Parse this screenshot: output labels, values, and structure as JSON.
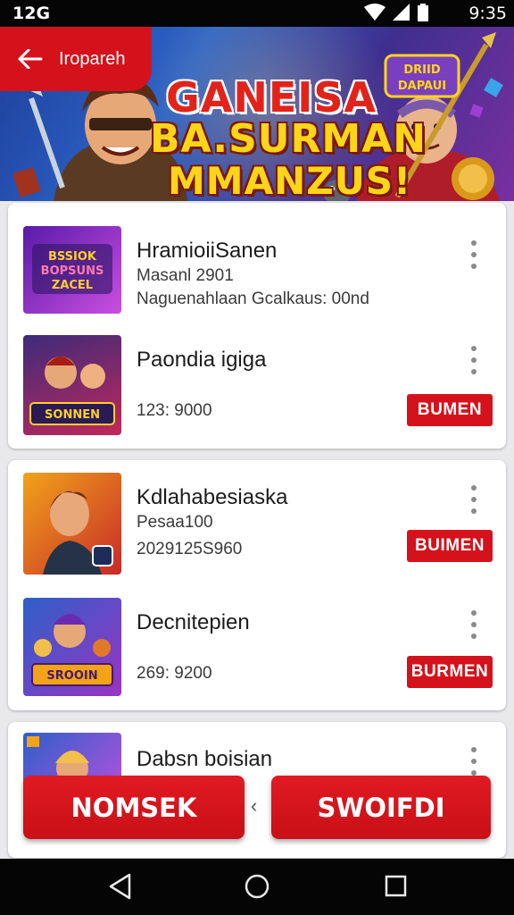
{
  "status_bar": {
    "time_left": "12G",
    "time_right": "9:35"
  },
  "header": {
    "back_label": "Iropareh"
  },
  "hero": {
    "line1": "GANEISA",
    "line2": "BA.SURMAN",
    "line3": "MMANZUS!"
  },
  "cards": [
    {
      "items": [
        {
          "title": "HramioiiSanen",
          "sub1": "Masanl 2901",
          "sub2": "Naguenahlaan Gcalkaus: 00nd",
          "button": ""
        },
        {
          "title": "Paondia igiga",
          "sub1": "",
          "sub2": "123: 9000",
          "button": "BUMEN"
        }
      ]
    },
    {
      "items": [
        {
          "title": "Kdlahabesiaska",
          "sub1": "Pesaa100",
          "sub2": "2029125S960",
          "button": "BUIMEN"
        },
        {
          "title": "Decnitepien",
          "sub1": "",
          "sub2": "269: 9200",
          "button": "BURMEN"
        }
      ]
    },
    {
      "items": [
        {
          "title": "Dabsn boisian",
          "sub1": "",
          "sub2": "",
          "button": ""
        }
      ]
    }
  ],
  "thumb_captions": [
    "BSSIOK BOPSUNS ZACEL",
    "SONNEN",
    "",
    "SROOIN",
    ""
  ],
  "actions": {
    "left": "NOMSEK",
    "separator": "‹",
    "right": "SWOIFDI"
  },
  "colors": {
    "accent": "#d5121b",
    "banner_yellow": "#ffd51a",
    "card_bg": "#ffffff"
  },
  "icons": [
    "back-arrow-icon",
    "wifi-icon",
    "signal-icon",
    "battery-icon",
    "more-vert-icon",
    "nav-back-icon",
    "nav-home-icon",
    "nav-recents-icon"
  ]
}
